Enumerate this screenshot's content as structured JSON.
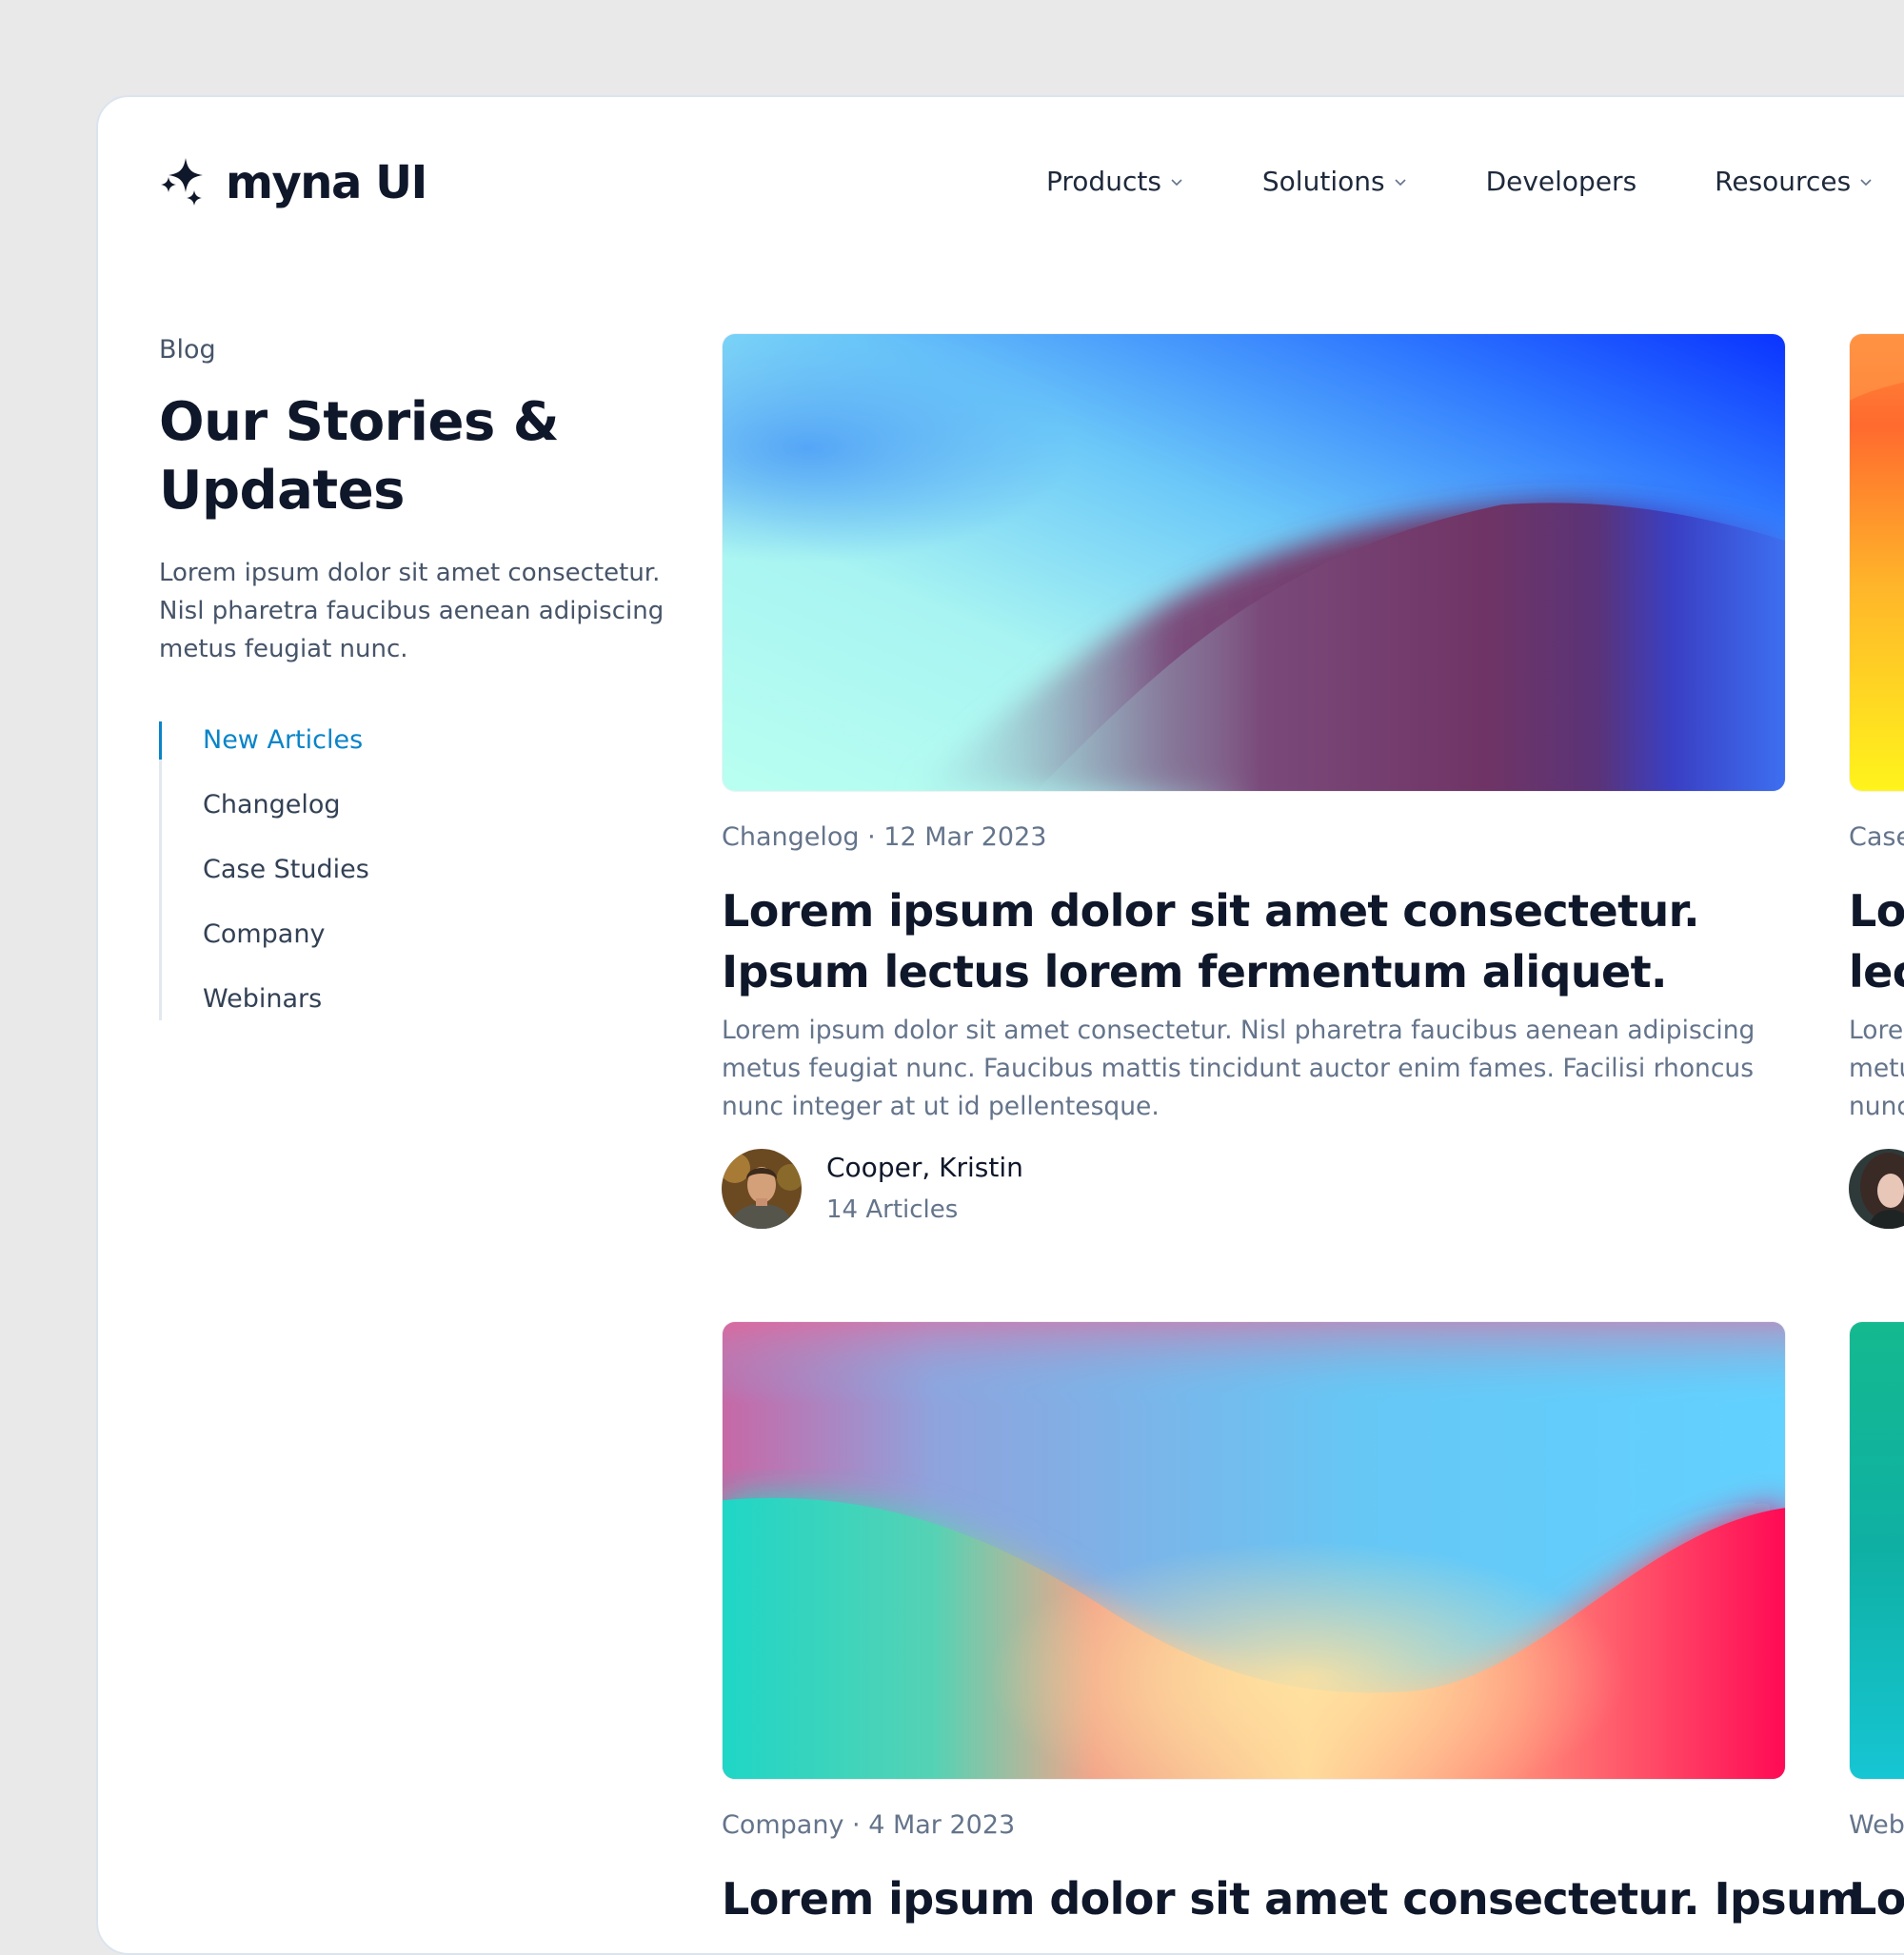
{
  "brand": {
    "name": "myna UI",
    "icon": "sparkles-icon"
  },
  "nav": {
    "items": [
      {
        "label": "Products",
        "has_dropdown": true
      },
      {
        "label": "Solutions",
        "has_dropdown": true
      },
      {
        "label": "Developers",
        "has_dropdown": false
      },
      {
        "label": "Resources",
        "has_dropdown": true
      }
    ]
  },
  "sidebar": {
    "eyebrow": "Blog",
    "title": "Our Stories & Updates",
    "intro": "Lorem ipsum dolor sit amet consectetur. Nisl pharetra faucibus aenean adipiscing metus feugiat nunc.",
    "categories": [
      {
        "label": "New Articles",
        "active": true
      },
      {
        "label": "Changelog",
        "active": false
      },
      {
        "label": "Case Studies",
        "active": false
      },
      {
        "label": "Company",
        "active": false
      },
      {
        "label": "Webinars",
        "active": false
      }
    ]
  },
  "articles": [
    {
      "meta": "Changelog · 12 Mar 2023",
      "title": "Lorem ipsum dolor sit amet consectetur. Ipsum lectus lorem fermentum aliquet.",
      "excerpt": "Lorem ipsum dolor sit amet consectetur. Nisl pharetra faucibus aenean adipiscing metus feugiat nunc. Faucibus mattis tincidunt auctor enim fames. Facilisi rhoncus nunc integer at ut id pellentesque.",
      "author": {
        "name": "Cooper, Kristin",
        "articles": "14 Articles"
      }
    },
    {
      "meta": "Case",
      "title": "Lo\nlec",
      "excerpt": "Lore\nmetu\nnunc"
    },
    {
      "meta": "Company · 4 Mar 2023",
      "title": "Lorem ipsum dolor sit amet consectetur. Ipsum"
    },
    {
      "meta": "Web",
      "title": "Lo"
    }
  ],
  "colors": {
    "accent": "#0a84c8",
    "text_primary": "#0f172a",
    "text_muted": "#64748b",
    "background": "#e9e9ea"
  }
}
